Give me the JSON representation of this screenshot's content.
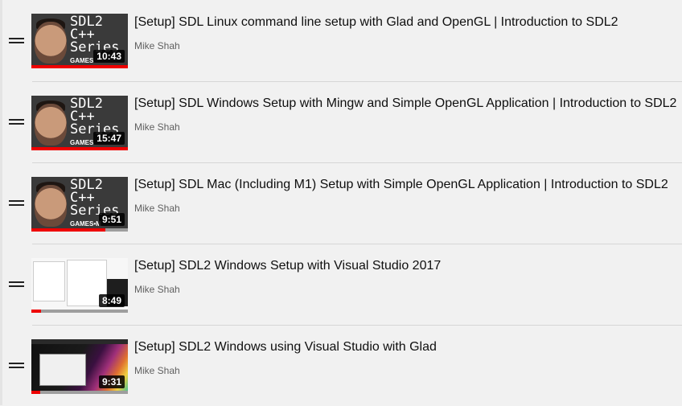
{
  "playlist": {
    "items": [
      {
        "title": "[Setup] SDL Linux command line setup with Glad and OpenGL | Introduction to SDL2",
        "channel": "Mike Shah",
        "duration": "10:43",
        "thumbnail": "sdl2",
        "thumb_text": "SDL2\nC++\nSeries",
        "thumb_brand": "GAMES",
        "watched_fraction": 1.0
      },
      {
        "title": "[Setup] SDL Windows Setup with Mingw and Simple OpenGL Application | Introduction to SDL2",
        "channel": "Mike Shah",
        "duration": "15:47",
        "thumbnail": "sdl2",
        "thumb_text": "SDL2\nC++\nSeries",
        "thumb_brand": "GAMES",
        "watched_fraction": 1.0
      },
      {
        "title": "[Setup] SDL Mac (Including M1) Setup with Simple OpenGL Application | Introduction to SDL2",
        "channel": "Mike Shah",
        "duration": "9:51",
        "thumbnail": "sdl2",
        "thumb_text": "SDL2\nC++\nSeries",
        "thumb_brand": "GAMES•M",
        "watched_fraction": 0.77
      },
      {
        "title": "[Setup] SDL2 Windows Setup with Visual Studio 2017",
        "channel": "Mike Shah",
        "duration": "8:49",
        "thumbnail": "windows-screenshot",
        "watched_fraction": 0.1
      },
      {
        "title": "[Setup] SDL2 Windows using Visual Studio with Glad",
        "channel": "Mike Shah",
        "duration": "9:31",
        "thumbnail": "windows-desktop",
        "watched_fraction": 0.09
      }
    ]
  },
  "icons": {
    "drag_handle": "drag-handle-icon"
  },
  "colors": {
    "background": "#f1f1f1",
    "progress": "#ee0000",
    "title": "#0f0f0f",
    "channel": "#606060"
  }
}
